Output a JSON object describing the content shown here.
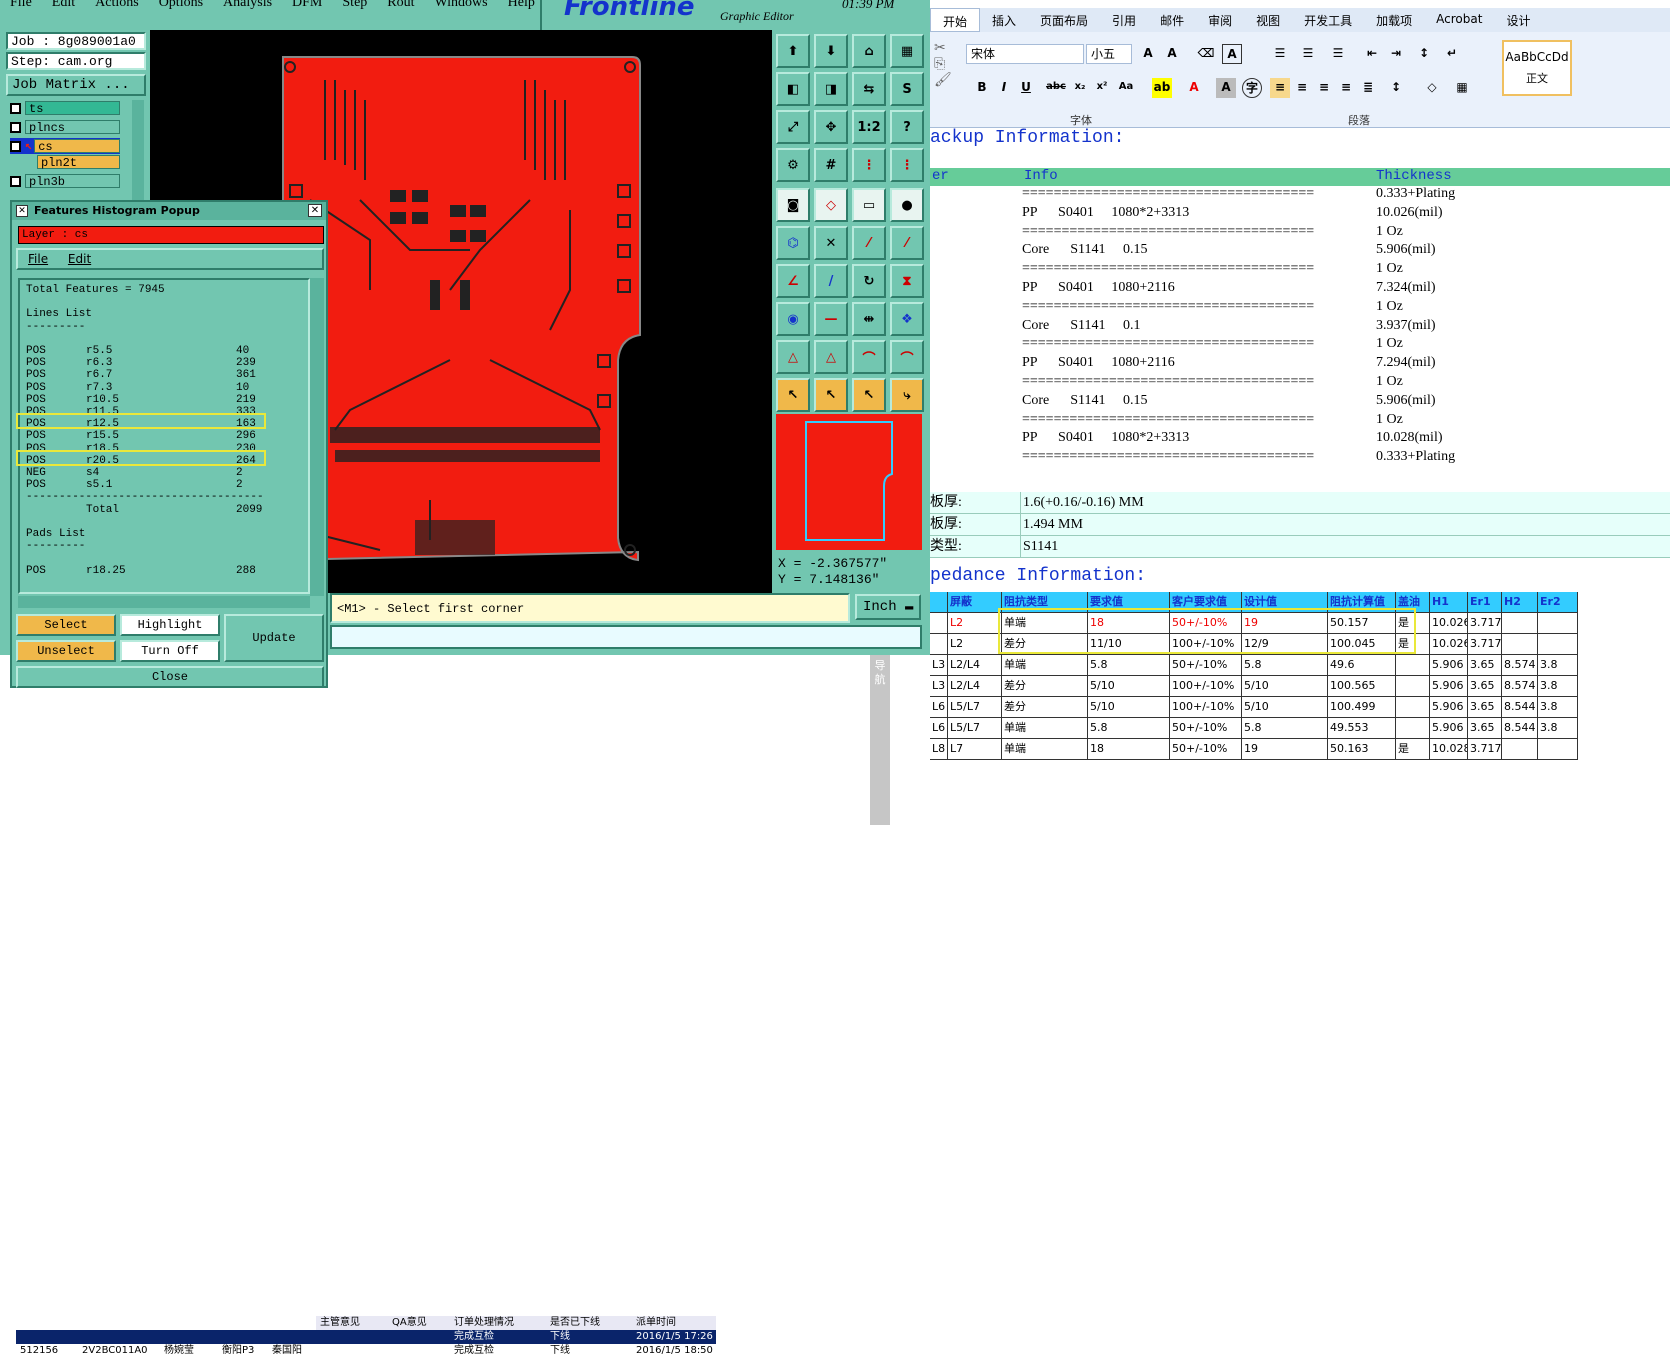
{
  "cam": {
    "menu": [
      "File",
      "Edit",
      "Actions",
      "Options",
      "Analysis",
      "DFM",
      "Step",
      "Rout",
      "Windows",
      "Help"
    ],
    "logo": "Frontline",
    "logo_sub": "Graphic Editor",
    "clock": "01:39 PM",
    "job": "Job : 8g089001a0",
    "step": "Step: cam.org",
    "job_matrix": "Job Matrix ...",
    "layers": [
      "ts",
      "plncs",
      "cs",
      "pln2t",
      "pln3b"
    ],
    "status_prompt": "<M1> - Select first corner",
    "unit": "Inch",
    "coord_x": "X = -2.367577\"",
    "coord_y": "Y = 7.148136\"",
    "colors": {
      "panel": "#72c6b0",
      "board": "#f21c10",
      "active_layer": "#f0b84a"
    }
  },
  "histogram": {
    "title": "Features Histogram Popup",
    "layer": "Layer :  cs",
    "menu": [
      "File",
      "Edit"
    ],
    "total": "Total Features = 7945",
    "lines_title": "Lines List",
    "rows": [
      [
        "POS",
        "r5.5",
        "40"
      ],
      [
        "POS",
        "r6.3",
        "239"
      ],
      [
        "POS",
        "r6.7",
        "361"
      ],
      [
        "POS",
        "r7.3",
        "10"
      ],
      [
        "POS",
        "r10.5",
        "219"
      ],
      [
        "POS",
        "r11.5",
        "333"
      ],
      [
        "POS",
        "r12.5",
        "163"
      ],
      [
        "POS",
        "r15.5",
        "296"
      ],
      [
        "POS",
        "r18.5",
        "230"
      ],
      [
        "POS",
        "r20.5",
        "264"
      ],
      [
        "NEG",
        "s4",
        "2"
      ],
      [
        "POS",
        "s5.1",
        "2"
      ]
    ],
    "total_label": "Total",
    "total_value": "2099",
    "pads_title": "Pads List",
    "pad_row": [
      "POS",
      "r18.25",
      "288"
    ],
    "buttons": {
      "select": "Select",
      "highlight": "Highlight",
      "update": "Update",
      "unselect": "Unselect",
      "turn_off": "Turn Off",
      "close": "Close"
    }
  },
  "tasks": {
    "headers": [
      "主管意见",
      "QA意见",
      "订单处理情况",
      "是否已下线",
      "派单时间"
    ],
    "row1": [
      "",
      "",
      "完成互检",
      "下线",
      "2016/1/5 17:26"
    ],
    "row2": [
      "512156",
      "2V2BC011A0",
      "杨婉莹",
      "衡阳P3",
      "秦国阳",
      "",
      "完成互检",
      "下线",
      "2016/1/5 18:50"
    ],
    "side_tab": "导航"
  },
  "word": {
    "tabs": [
      "开始",
      "插入",
      "页面布局",
      "引用",
      "邮件",
      "审阅",
      "视图",
      "开发工具",
      "加载项",
      "Acrobat",
      "设计"
    ],
    "font_name": "宋体",
    "font_size": "小五",
    "group_font": "字体",
    "group_para": "段落",
    "style_sample": "AaBbCcDd",
    "style_name": "正文",
    "stack_title": "ackup Information:",
    "stack_headers": [
      "er",
      "Info",
      "Thickness"
    ],
    "stack_rows": [
      [
        "=====================================",
        "0.333+Plating"
      ],
      [
        "PP      S0401     1080*2+3313",
        "10.026(mil)"
      ],
      [
        "=====================================",
        "1 Oz"
      ],
      [
        "Core      S1141     0.15",
        "5.906(mil)"
      ],
      [
        "=====================================",
        "1 Oz"
      ],
      [
        "PP      S0401     1080+2116",
        "7.324(mil)"
      ],
      [
        "=====================================",
        "1 Oz"
      ],
      [
        "Core      S1141     0.1",
        "3.937(mil)"
      ],
      [
        "=====================================",
        "1 Oz"
      ],
      [
        "PP      S0401     1080+2116",
        "7.294(mil)"
      ],
      [
        "=====================================",
        "1 Oz"
      ],
      [
        "Core      S1141     0.15",
        "5.906(mil)"
      ],
      [
        "=====================================",
        "1 Oz"
      ],
      [
        "PP      S0401     1080*2+3313",
        "10.028(mil)"
      ],
      [
        "=====================================",
        "0.333+Plating"
      ]
    ],
    "thick_rows": [
      [
        "板厚:",
        "1.6(+0.16/-0.16) MM"
      ],
      [
        "板厚:",
        "1.494 MM"
      ],
      [
        "类型:",
        "S1141"
      ]
    ],
    "imp_title": "pedance Information:",
    "imp_headers": [
      "",
      "屏蔽",
      "阻抗类型",
      "要求值",
      "客户要求值",
      "设计值",
      "阻抗计算值",
      "盖油",
      "H1",
      "Er1",
      "H2",
      "Er2"
    ],
    "imp_rows": [
      [
        "",
        "L2",
        "单端",
        "18",
        "50+/-10%",
        "19",
        "50.157",
        "是",
        "10.026",
        "3.717",
        "",
        ""
      ],
      [
        "",
        "L2",
        "差分",
        "11/10",
        "100+/-10%",
        "12/9",
        "100.045",
        "是",
        "10.026",
        "3.717",
        "",
        ""
      ],
      [
        "L3",
        "L2/L4",
        "单端",
        "5.8",
        "50+/-10%",
        "5.8",
        "49.6",
        "",
        "5.906",
        "3.65",
        "8.574",
        "3.8"
      ],
      [
        "L3",
        "L2/L4",
        "差分",
        "5/10",
        "100+/-10%",
        "5/10",
        "100.565",
        "",
        "5.906",
        "3.65",
        "8.574",
        "3.8"
      ],
      [
        "L6",
        "L5/L7",
        "差分",
        "5/10",
        "100+/-10%",
        "5/10",
        "100.499",
        "",
        "5.906",
        "3.65",
        "8.544",
        "3.8"
      ],
      [
        "L6",
        "L5/L7",
        "单端",
        "5.8",
        "50+/-10%",
        "5.8",
        "49.553",
        "",
        "5.906",
        "3.65",
        "8.544",
        "3.8"
      ],
      [
        "L8",
        "L7",
        "单端",
        "18",
        "50+/-10%",
        "19",
        "50.163",
        "是",
        "10.028",
        "3.717",
        "",
        ""
      ]
    ]
  }
}
